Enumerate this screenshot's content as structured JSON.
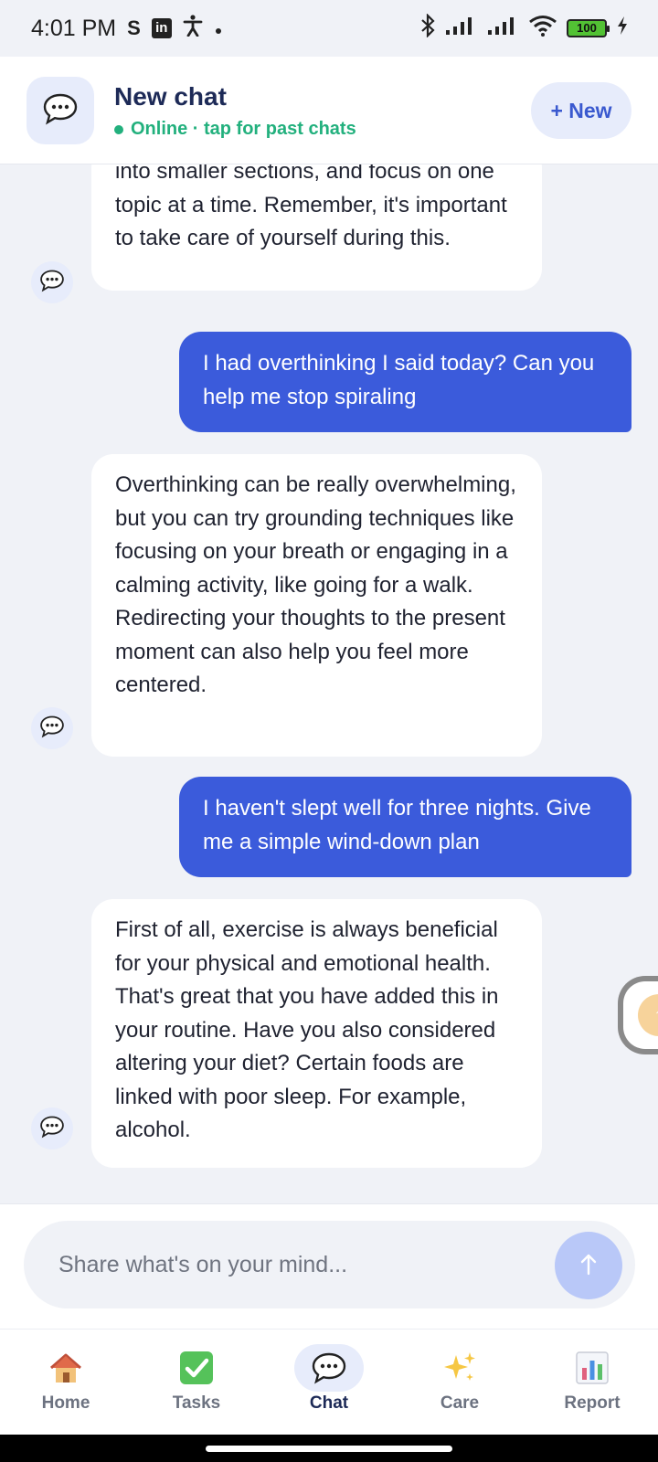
{
  "status_bar": {
    "time": "4:01 PM",
    "battery": "100"
  },
  "header": {
    "title": "New chat",
    "subtitle": "Online · tap for past chats",
    "new_button": "+ New"
  },
  "messages": [
    {
      "role": "bot",
      "text": "into smaller sections, and focus on one topic at a time. Remember, it's important to take care of yourself during this."
    },
    {
      "role": "user",
      "text": "I had overthinking I said  today? Can you help me stop spiraling"
    },
    {
      "role": "bot",
      "text": "Overthinking can be really overwhelming, but you can try grounding techniques like focusing on your breath or engaging in a calming activity, like going for a walk. Redirecting your thoughts to the present moment can also help you feel more centered."
    },
    {
      "role": "user",
      "text": "I haven't slept well for three nights. Give me a simple wind-down plan"
    },
    {
      "role": "bot",
      "text": "First of all, exercise is always beneficial for your physical and emotional health. That's great that you have added this in your routine. Have you also considered altering your diet? Certain foods are linked with poor sleep. For example, alcohol."
    }
  ],
  "composer": {
    "placeholder": "Share what's on your mind...",
    "send_glyph": "↑"
  },
  "nav": {
    "items": [
      {
        "label": "Home",
        "icon": "home-icon"
      },
      {
        "label": "Tasks",
        "icon": "check-icon"
      },
      {
        "label": "Chat",
        "icon": "chat-bubble-icon",
        "active": true
      },
      {
        "label": "Care",
        "icon": "sparkles-icon"
      },
      {
        "label": "Report",
        "icon": "bar-chart-icon"
      }
    ]
  },
  "colors": {
    "accent": "#3b5bdb",
    "online": "#22b07d",
    "title": "#1d2a57"
  }
}
